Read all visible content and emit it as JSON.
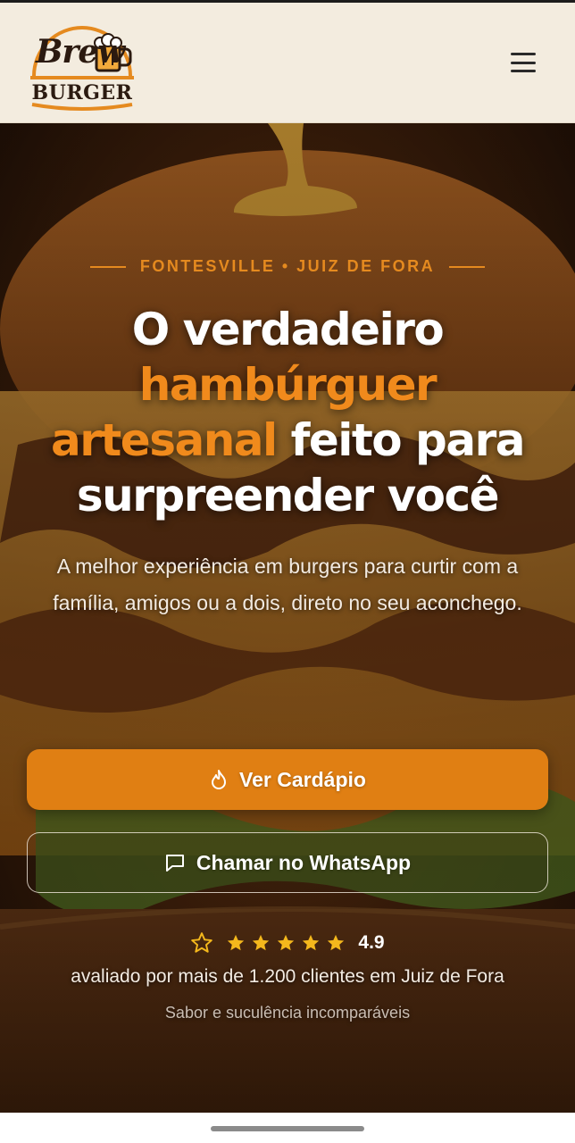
{
  "header": {
    "logo_top": "Brew",
    "logo_bottom": "BURGER",
    "menu_icon": "hamburger-menu-icon"
  },
  "hero": {
    "kicker": "FONTESVILLE • JUIZ DE FORA",
    "headline_1": "O verdadeiro",
    "headline_accent_1": "hambúrguer",
    "headline_accent_2": "artesanal",
    "headline_2": "feito para",
    "headline_3": "surpreender você",
    "subtitle": "A melhor experiência em burgers para curtir com a família, amigos ou a dois, direto no seu aconchego.",
    "primary_button": "Ver Cardápio",
    "primary_icon": "flame-icon",
    "secondary_button": "Chamar no WhatsApp",
    "secondary_icon": "chat-icon",
    "rating_value": "4.9",
    "rating_stars": 5,
    "rating_caption": "avaliado por mais de 1.200 clientes em Juiz de Fora",
    "tagline": "Sabor e suculência incomparáveis"
  },
  "colors": {
    "accent": "#e07f13",
    "header_bg": "#f3ecdf",
    "star": "#f4b81c"
  }
}
